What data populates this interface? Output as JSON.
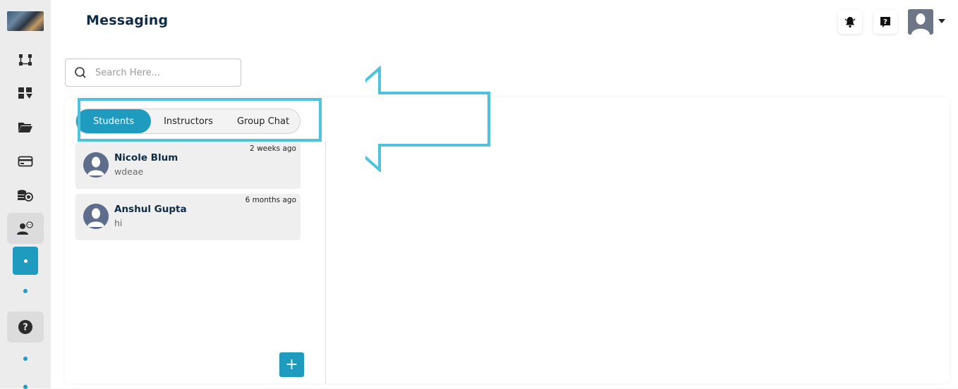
{
  "page": {
    "title": "Messaging"
  },
  "sidebar": {
    "items": [
      {
        "icon": "workflow-icon"
      },
      {
        "icon": "dashboard-icon"
      },
      {
        "icon": "folder-icon"
      },
      {
        "icon": "card-icon"
      },
      {
        "icon": "coins-icon"
      },
      {
        "icon": "user-chat-icon",
        "active": true
      },
      {
        "icon": "help-icon"
      }
    ]
  },
  "header": {
    "notification_icon": "bell-icon",
    "help_icon": "question-icon",
    "avatar_icon": "user-avatar-icon"
  },
  "search": {
    "placeholder": "Search Here..."
  },
  "tabs": [
    {
      "label": "Students",
      "active": true
    },
    {
      "label": "Instructors",
      "active": false
    },
    {
      "label": "Group Chat",
      "active": false
    }
  ],
  "conversations": [
    {
      "name": "Nicole Blum",
      "preview": "wdeae",
      "time": "2 weeks ago"
    },
    {
      "name": "Anshul Gupta",
      "preview": "hi",
      "time": "6 months ago"
    }
  ],
  "add_button": {
    "label": "+"
  },
  "colors": {
    "accent": "#1f9bbf",
    "annotation": "#4fc3dc",
    "title": "#0f2c44"
  }
}
